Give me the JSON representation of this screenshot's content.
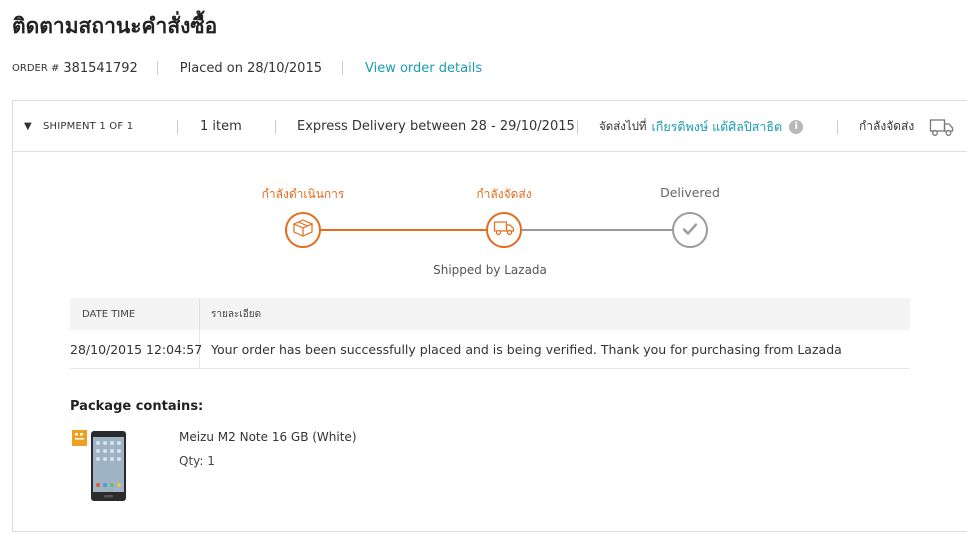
{
  "page": {
    "title": "ติดตามสถานะคำสั่งซื้อ"
  },
  "order": {
    "label": "ORDER #",
    "number": "381541792",
    "placed": "Placed on 28/10/2015",
    "view_details": "View order details"
  },
  "shipment": {
    "caret": "▼",
    "label": "SHIPMENT 1 OF 1",
    "items": "1 item",
    "delivery": "Express Delivery between 28 - 29/10/2015",
    "ship_to_label": "จัดส่งไปที่",
    "ship_to_name": "เกียรดิพงษ์ แด้ศิลปิสาธิต",
    "status": "กำลังจัดส่ง"
  },
  "tracker": {
    "steps": [
      {
        "label": "กำลังดำเนินการ",
        "state": "complete",
        "icon": "box-icon"
      },
      {
        "label": "กำลังจัดส่ง",
        "state": "current",
        "icon": "truck-icon"
      },
      {
        "label": "Delivered",
        "state": "pending",
        "icon": "check-icon"
      }
    ],
    "shipped_by": "Shipped by Lazada"
  },
  "log": {
    "headers": [
      "DATE TIME",
      "รายละเอียด"
    ],
    "rows": [
      {
        "datetime": "28/10/2015 12:04:57",
        "detail": "Your order has been successfully placed and is being verified. Thank you for purchasing from Lazada"
      }
    ]
  },
  "package": {
    "title": "Package contains:",
    "product": {
      "name": "Meizu M2 Note 16 GB (White)",
      "qty": "Qty: 1"
    }
  },
  "colors": {
    "accent": "#e46c1d",
    "link": "#1a9cb0",
    "pending": "#9a9a9a"
  }
}
